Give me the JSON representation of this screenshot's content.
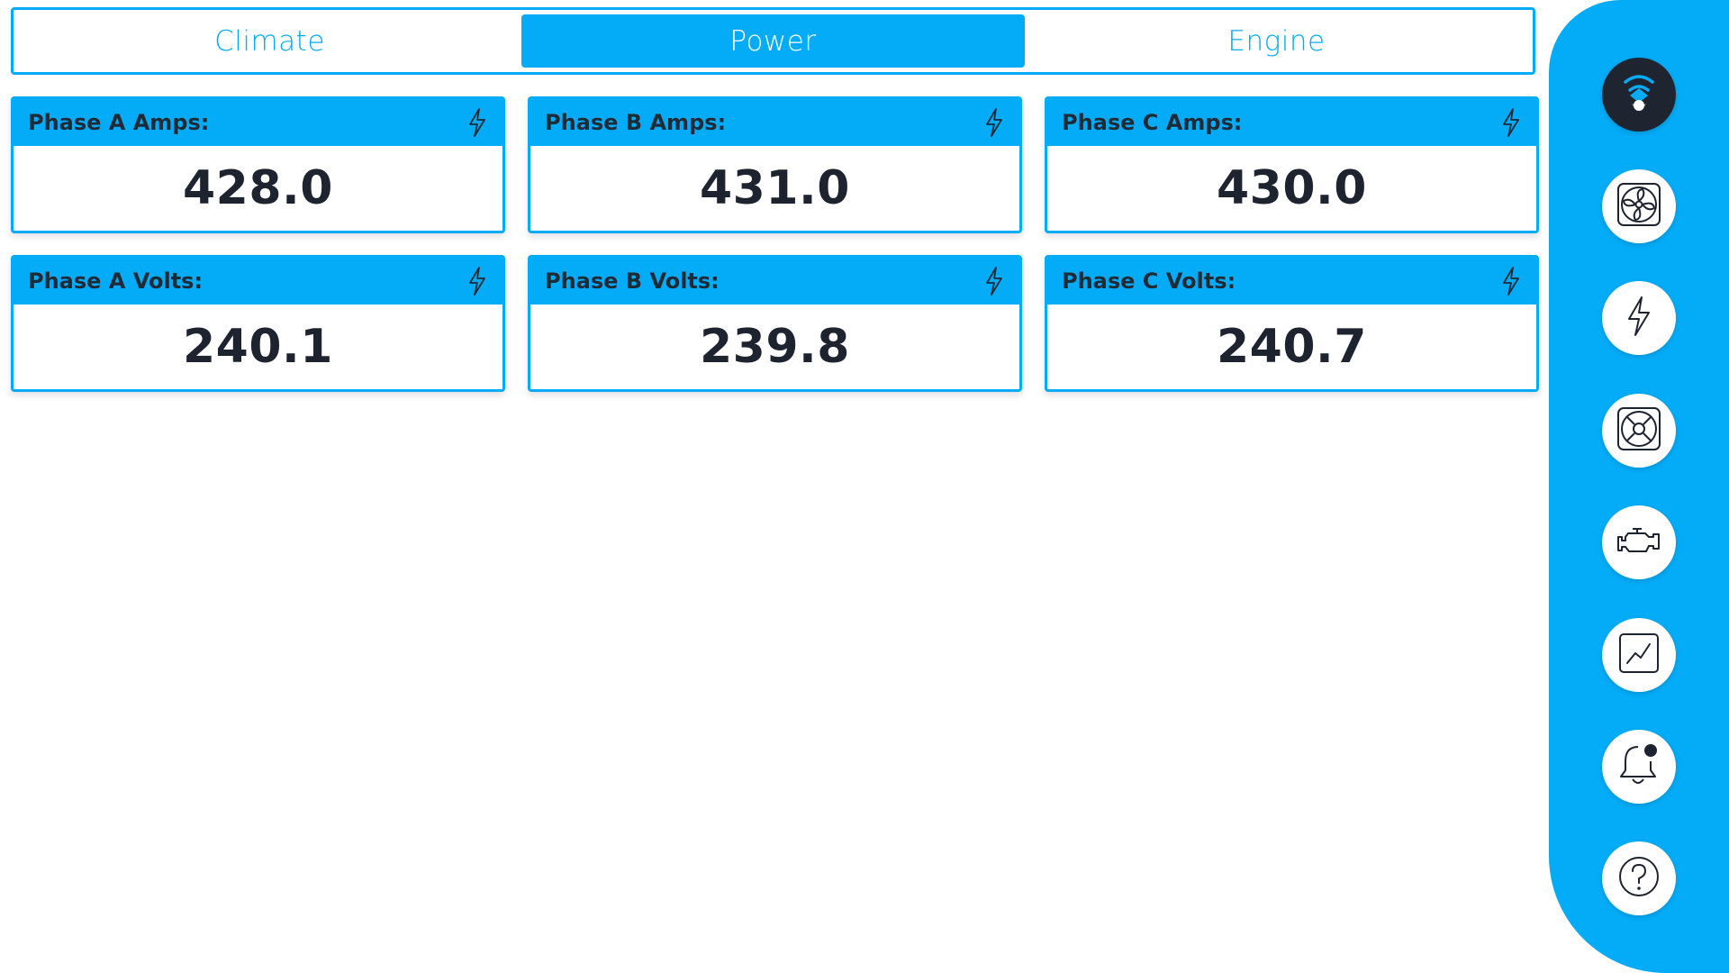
{
  "tabs": [
    {
      "label": "Climate",
      "active": false
    },
    {
      "label": "Power",
      "active": true
    },
    {
      "label": "Engine",
      "active": false
    }
  ],
  "cards": [
    {
      "title": "Phase A Amps:",
      "value": "428.0",
      "icon": "lightning-icon"
    },
    {
      "title": "Phase B Amps:",
      "value": "431.0",
      "icon": "lightning-icon"
    },
    {
      "title": "Phase C Amps:",
      "value": "430.0",
      "icon": "lightning-icon"
    },
    {
      "title": "Phase A Volts:",
      "value": "240.1",
      "icon": "lightning-icon"
    },
    {
      "title": "Phase B Volts:",
      "value": "239.8",
      "icon": "lightning-icon"
    },
    {
      "title": "Phase C Volts:",
      "value": "240.7",
      "icon": "lightning-icon"
    }
  ],
  "sidebar": {
    "items": [
      {
        "icon": "logo-icon",
        "active": true
      },
      {
        "icon": "fan-icon"
      },
      {
        "icon": "lightning-icon"
      },
      {
        "icon": "ventilation-icon"
      },
      {
        "icon": "engine-icon"
      },
      {
        "icon": "chart-icon"
      },
      {
        "icon": "notification-bell-icon"
      },
      {
        "icon": "help-icon"
      }
    ]
  },
  "colors": {
    "accent": "#04acf7",
    "dark": "#1f2530",
    "text": "#1e2330"
  }
}
